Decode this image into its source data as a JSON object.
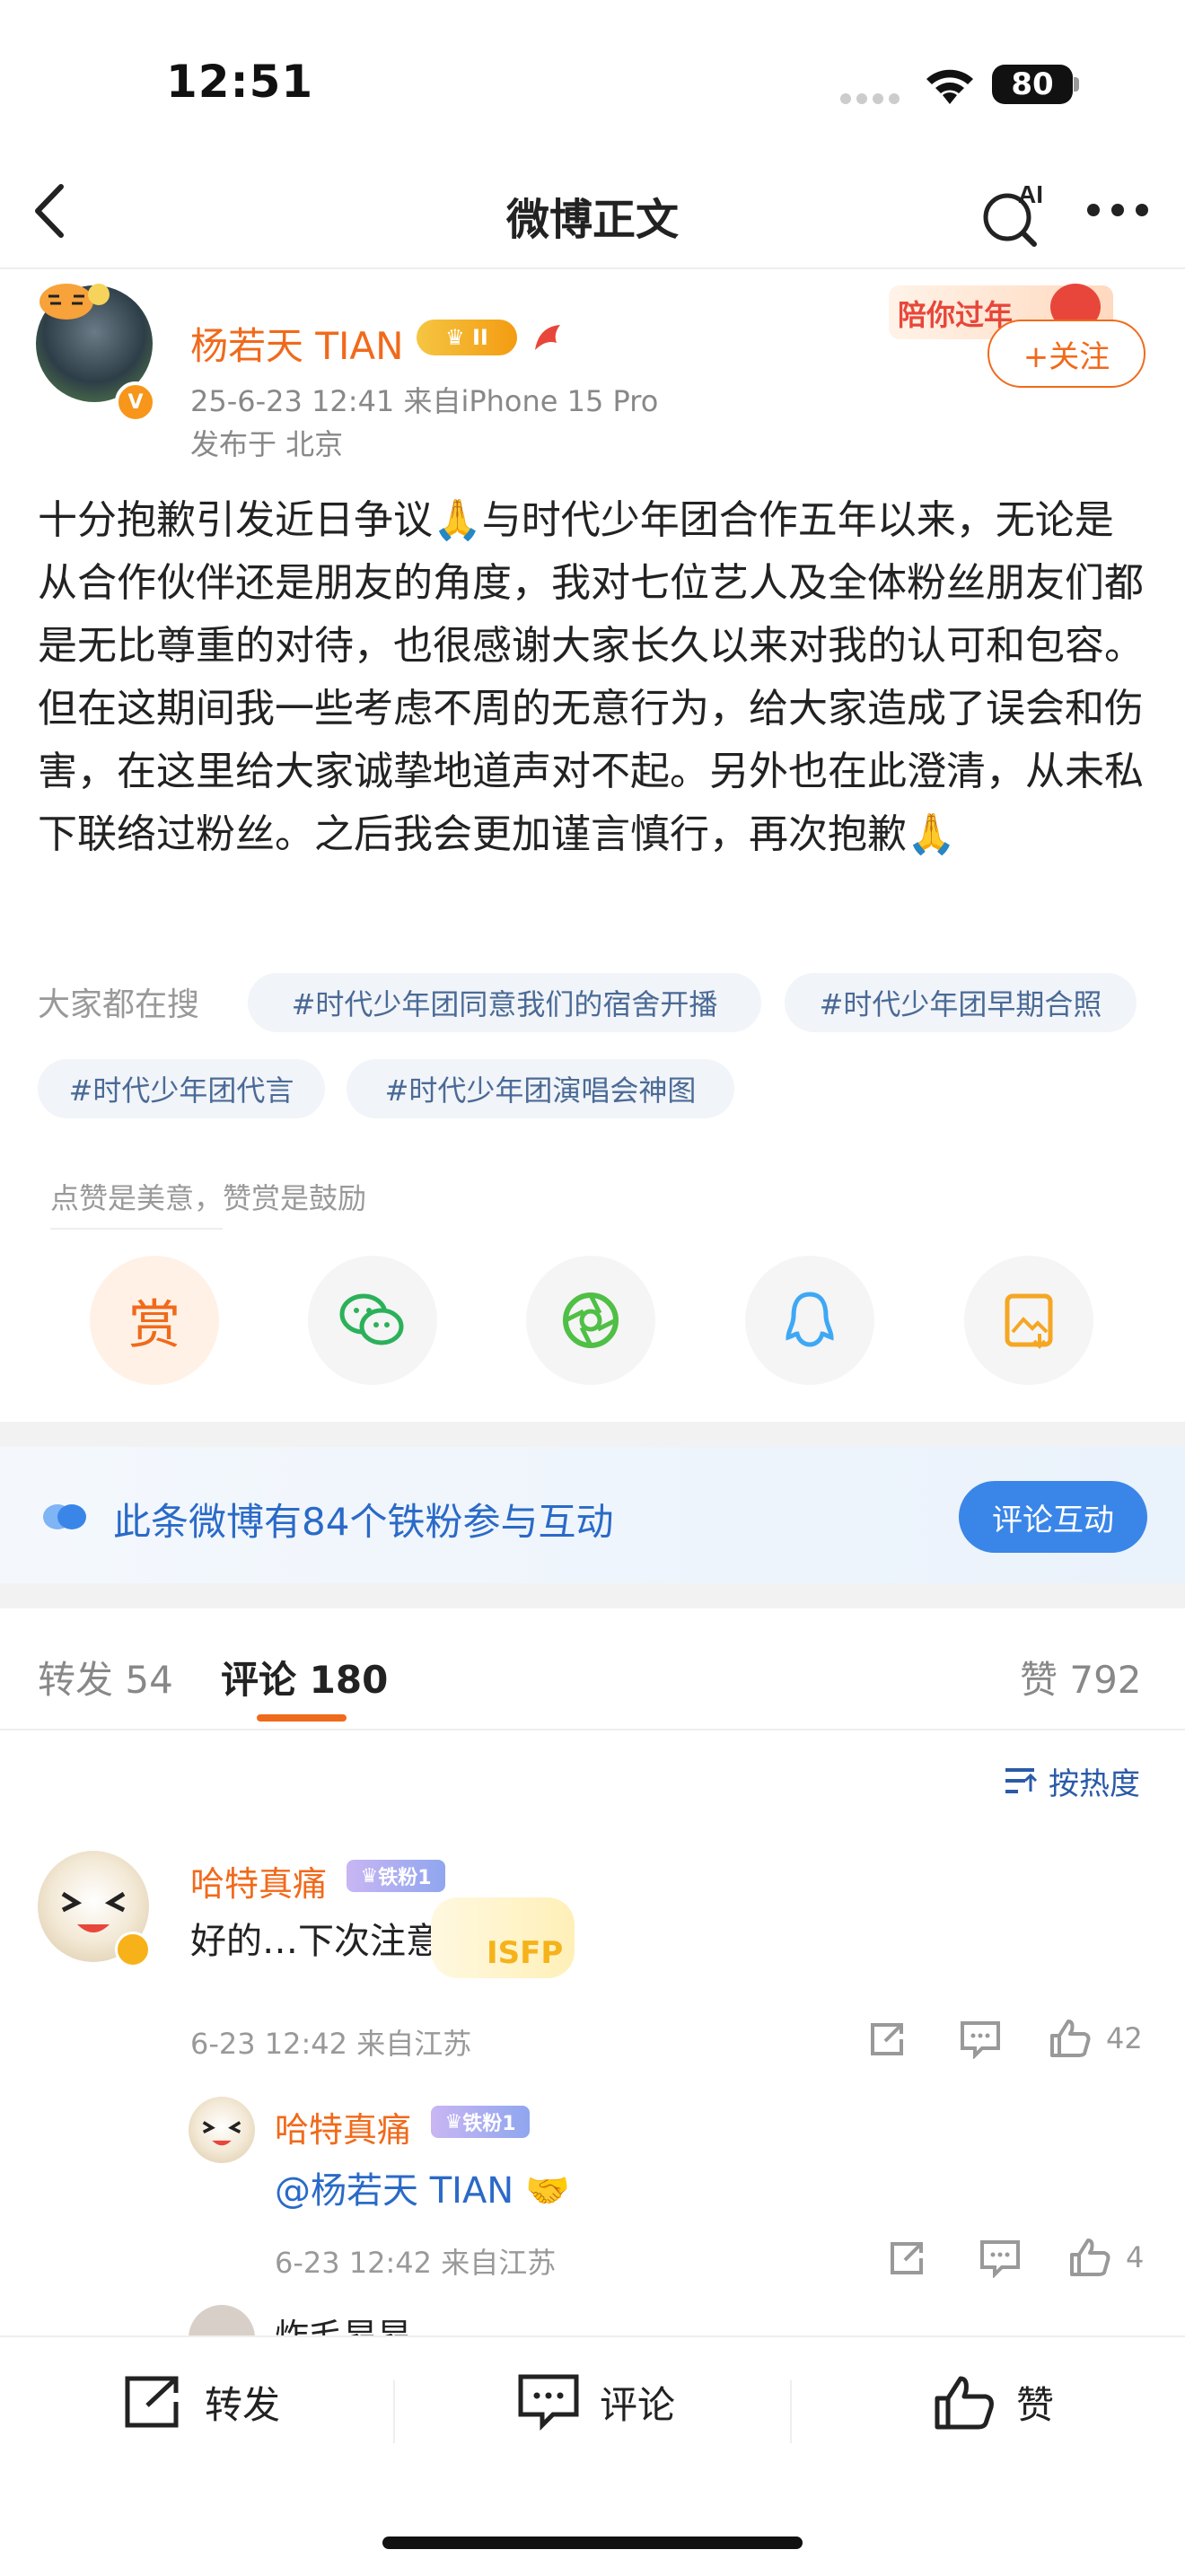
{
  "status_bar": {
    "time": "12:51",
    "battery": "80"
  },
  "nav": {
    "title": "微博正文",
    "ai_label": "AI"
  },
  "post": {
    "author": "杨若天 TIAN",
    "level_badge": "II",
    "meta": "25-6-23 12:41  来自iPhone 15 Pro",
    "location": "发布于 北京",
    "follow_label": "+关注",
    "follow_banner": "陪你过年",
    "text": "十分抱歉引发近日争议🙏与时代少年团合作五年以来，无论是从合作伙伴还是朋友的角度，我对七位艺人及全体粉丝朋友们都是无比尊重的对待，也很感谢大家长久以来对我的认可和包容。但在这期间我一些考虑不周的无意行为，给大家造成了误会和伤害，在这里给大家诚挚地道声对不起。另外也在此澄清，从未私下联络过粉丝。之后我会更加谨言慎行，再次抱歉🙏"
  },
  "hot_search": {
    "label": "大家都在搜",
    "tags": [
      "#时代少年团同意我们的宿舍开播",
      "#时代少年团早期合照",
      "#时代少年团代言",
      "#时代少年团演唱会神图"
    ]
  },
  "reward": {
    "tip": "点赞是美意，赞赏是鼓励",
    "reward_label": "赏"
  },
  "fans_banner": {
    "text": "此条微博有84个铁粉参与互动",
    "button": "评论互动"
  },
  "tabs": {
    "repost": "转发 54",
    "comment": "评论 180",
    "like": "赞 792"
  },
  "sort_label": "按热度",
  "comments": [
    {
      "name": "哈特真痛",
      "fan_badge": "铁粉1",
      "text": "好的…下次注意！",
      "meta": "6-23 12:42  来自江苏",
      "likes": "42",
      "sticker": "ISFP"
    },
    {
      "name": "哈特真痛",
      "fan_badge": "铁粉1",
      "text": "@杨若天 TIAN 🤝",
      "meta": "6-23 12:42  来自江苏",
      "likes": "4"
    },
    {
      "name": "炸毛昂昂"
    }
  ],
  "toolbar": {
    "repost": "转发",
    "comment": "评论",
    "like": "赞"
  },
  "colors": {
    "accent": "#f06a1b",
    "link_blue": "#2a6ac8",
    "tag_text": "#4a6a96"
  }
}
